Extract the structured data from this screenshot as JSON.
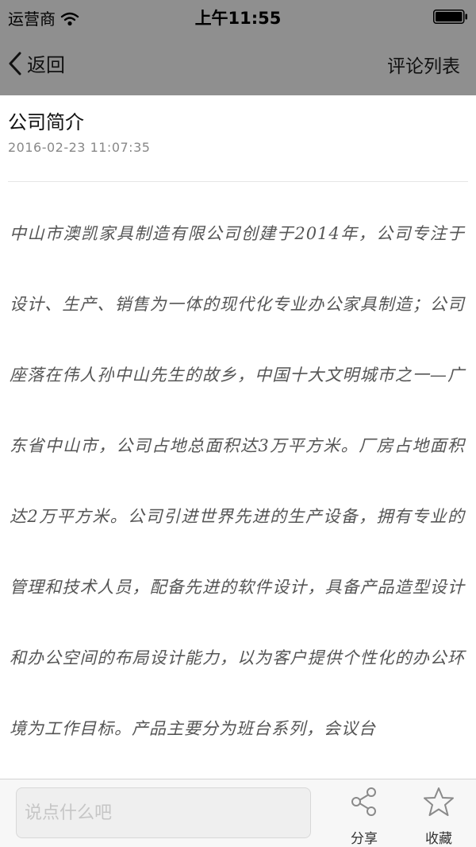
{
  "status_bar": {
    "carrier": "运营商",
    "time": "上午11:55",
    "wifi_icon": "wifi-icon",
    "battery_icon": "battery-icon"
  },
  "nav": {
    "back_label": "返回",
    "back_icon": "chevron-left-icon",
    "right_label": "评论列表"
  },
  "article": {
    "title": "公司简介",
    "date": "2016-02-23  11:07:35",
    "body": "中山市澳凯家具制造有限公司创建于2014年，公司专注于设计、生产、销售为一体的现代化专业办公家具制造；公司座落在伟人孙中山先生的故乡，中国十大文明城市之一—广东省中山市，公司占地总面积达3万平方米。厂房占地面积达2万平方米。公司引进世界先进的生产设备，拥有专业的管理和技术人员，配备先进的软件设计，具备产品造型设计和办公空间的布局设计能力，以为客户提供个性化的办公环境为工作目标。产品主要分为班台系列，会议台"
  },
  "toolbar": {
    "comment_placeholder": "说点什么吧",
    "comment_value": "",
    "share_label": "分享",
    "share_icon": "share-icon",
    "favorite_label": "收藏",
    "favorite_icon": "star-icon"
  },
  "colors": {
    "nav_background": "#8f8f8f",
    "body_text": "#555555",
    "date_text": "#888888"
  }
}
